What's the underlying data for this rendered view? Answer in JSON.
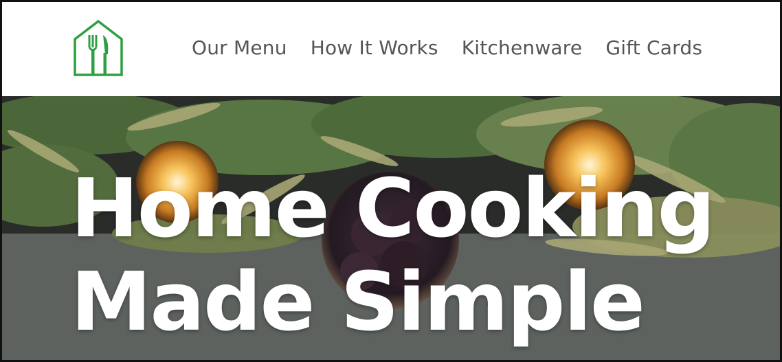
{
  "header": {
    "logo_icon": "house-fork-knife-icon",
    "nav": [
      {
        "label": "Our Menu"
      },
      {
        "label": "How It Works"
      },
      {
        "label": "Kitchenware"
      },
      {
        "label": "Gift Cards"
      }
    ]
  },
  "hero": {
    "headline_line1": "Home Cooking",
    "headline_line2": "Made Simple"
  },
  "colors": {
    "brand_green": "#2ea043",
    "nav_text": "#555555",
    "headline": "#ffffff"
  }
}
